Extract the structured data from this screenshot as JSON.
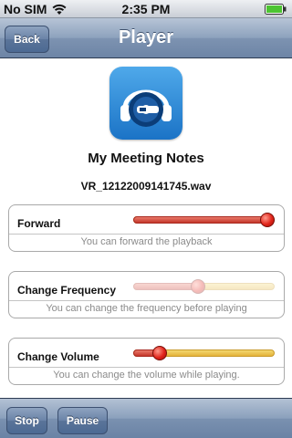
{
  "status_bar": {
    "carrier": "No SIM",
    "time": "2:35 PM",
    "wifi_icon": "wifi-icon",
    "battery_icon": "battery-icon"
  },
  "nav": {
    "back_label": "Back",
    "title": "Player"
  },
  "app_icon": "headphones-disc-icon",
  "recording": {
    "title": "My Meeting Notes",
    "filename": "VR_12122009141745.wav"
  },
  "controls": [
    {
      "label": "Forward",
      "hint": "You can forward the playback",
      "value": 1.0,
      "enabled": true
    },
    {
      "label": "Change Frequency",
      "hint": "You can change the frequency before playing",
      "value": 0.45,
      "enabled": false
    },
    {
      "label": "Change Volume",
      "hint": "You can change the volume while playing.",
      "value": 0.15,
      "enabled": true
    }
  ],
  "toolbar": {
    "stop_label": "Stop",
    "pause_label": "Pause"
  },
  "colors": {
    "nav_blue": "#7d93b1",
    "slider_fill": "#c4362a",
    "slider_track": "#e4b33a",
    "thumb": "#e0241a"
  }
}
